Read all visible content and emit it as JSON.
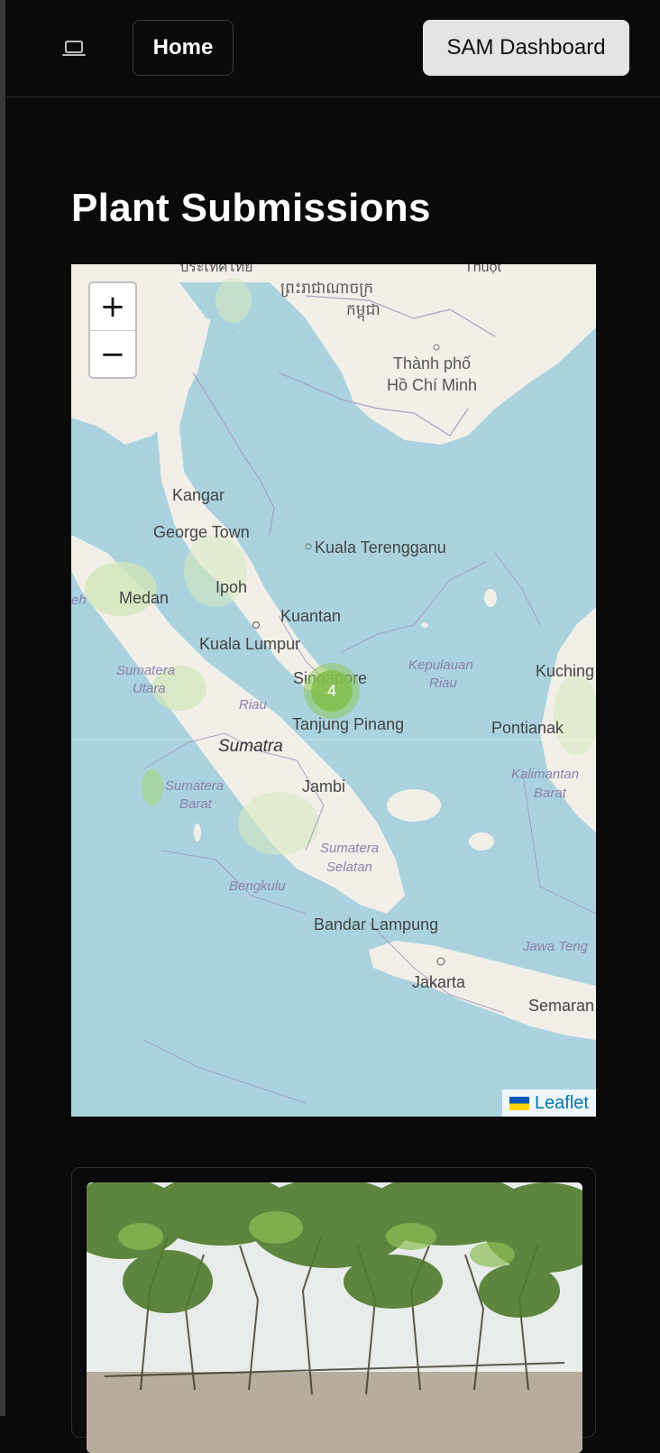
{
  "header": {
    "laptop_icon": "laptop-icon",
    "home_label": "Home",
    "dashboard_label": "SAM Dashboard"
  },
  "page": {
    "title": "Plant Submissions"
  },
  "map": {
    "zoom_in": "+",
    "zoom_out": "−",
    "attribution": "Leaflet",
    "cluster_count": "4",
    "labels": {
      "thai": "ประเทศไทย",
      "khmer_1": "ព្រះរាជាណាចក្រ",
      "khmer_2": "កម្ពុជា",
      "thuot": "Thuột",
      "hcm_1": "Thành phố",
      "hcm_2": "Hồ Chí Minh",
      "kangar": "Kangar",
      "george_town": "George Town",
      "kuala_terengganu": "Kuala Terengganu",
      "medan": "Medan",
      "ipoh": "Ipoh",
      "kuantan": "Kuantan",
      "kuala_lumpur": "Kuala Lumpur",
      "sumatera_utara_1": "Sumatera",
      "sumatera_utara_2": "Utara",
      "singapore": "Singapore",
      "kepulauan_1": "Kepulauan",
      "kepulauan_2": "Riau",
      "kuching": "Kuching",
      "riau": "Riau",
      "tanjung_pinang": "Tanjung Pinang",
      "pontianak": "Pontianak",
      "sumatra": "Sumatra",
      "kalimantan_1": "Kalimantan",
      "kalimantan_2": "Barat",
      "sumatera_barat_1": "Sumatera",
      "sumatera_barat_2": "Barat",
      "jambi": "Jambi",
      "sumatera_selatan_1": "Sumatera",
      "sumatera_selatan_2": "Selatan",
      "bengkulu": "Bengkulu",
      "bandar_lampung": "Bandar Lampung",
      "jawa_tengah": "Jawa Teng",
      "jakarta": "Jakarta",
      "semarang": "Semaran",
      "eh": "eh"
    }
  },
  "card": {
    "photo_alt": "plant-photo"
  },
  "colors": {
    "background": "#0a0a0a",
    "water": "#aad3df",
    "land": "#f2efe9",
    "cluster": "#80be46"
  }
}
